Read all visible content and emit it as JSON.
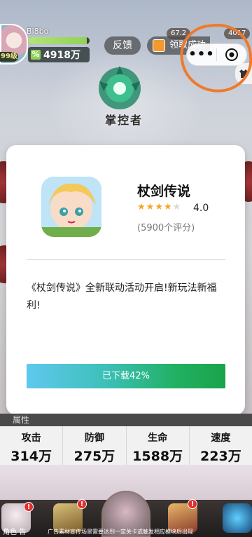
{
  "player": {
    "name": "Bi8bo",
    "level": "99级",
    "power": "4918万",
    "exp_fraction": 0.95
  },
  "top_bar": {
    "feedback_label": "反馈",
    "reward_label": "领取成功",
    "skip_label": "跳过",
    "currency_1": "67.2",
    "currency_2": "4017"
  },
  "capsule": {
    "more_label": "•••"
  },
  "emblem": {
    "label": "掌控者"
  },
  "ad": {
    "app_name": "杖剑传说",
    "rating_value": "4.0",
    "rating_stars": 4,
    "rating_max": 5,
    "rating_count": "(5900个评分)",
    "description": "《杖剑传说》全新联动活动开启!新玩法新福利!",
    "download_label": "已下载42%",
    "download_progress": 0.42,
    "colors": {
      "star_filled": "#f5a623",
      "star_empty": "#d9d9d9",
      "progress_start": "#5fc8ef",
      "progress_end": "#1aa34a"
    }
  },
  "attributes": {
    "header": "属性",
    "items": [
      {
        "label": "攻击",
        "value": "314万"
      },
      {
        "label": "防御",
        "value": "275万"
      },
      {
        "label": "生命",
        "value": "1588万"
      },
      {
        "label": "速度",
        "value": "223万"
      }
    ]
  },
  "footer": {
    "ad_tag": "角色 告",
    "disclaimer": "广告素材宣传场景需要达到一定关卡或触发相应模块后出现"
  },
  "annotation": {
    "color": "#f07a2c"
  }
}
